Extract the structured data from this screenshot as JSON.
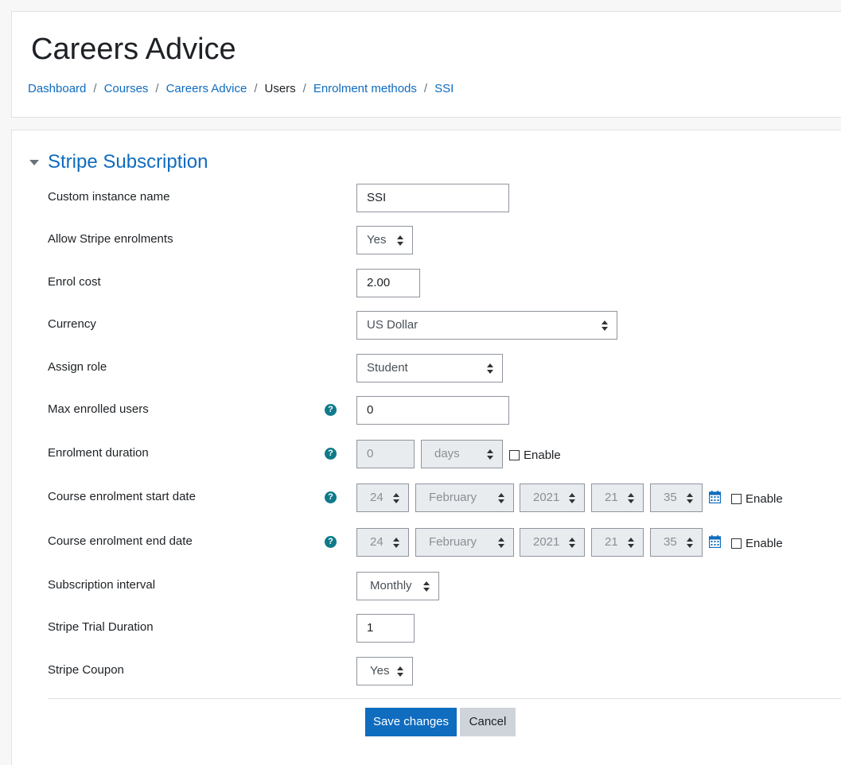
{
  "header": {
    "title": "Careers Advice",
    "breadcrumb": [
      "Dashboard",
      "Courses",
      "Careers Advice",
      "Users",
      "Enrolment methods",
      "SSI"
    ]
  },
  "form": {
    "section_title": "Stripe Subscription",
    "fields": {
      "instance_name": {
        "label": "Custom instance name",
        "value": "SSI"
      },
      "allow_enrol": {
        "label": "Allow Stripe enrolments",
        "value": "Yes"
      },
      "enrol_cost": {
        "label": "Enrol cost",
        "value": "2.00"
      },
      "currency": {
        "label": "Currency",
        "value": "US Dollar"
      },
      "assign_role": {
        "label": "Assign role",
        "value": "Student"
      },
      "max_users": {
        "label": "Max enrolled users",
        "value": "0"
      },
      "duration": {
        "label": "Enrolment duration",
        "value": "0",
        "unit": "days",
        "enable_label": "Enable"
      },
      "start_date": {
        "label": "Course enrolment start date",
        "day": "24",
        "month": "February",
        "year": "2021",
        "hour": "21",
        "minute": "35",
        "enable_label": "Enable"
      },
      "end_date": {
        "label": "Course enrolment end date",
        "day": "24",
        "month": "February",
        "year": "2021",
        "hour": "21",
        "minute": "35",
        "enable_label": "Enable"
      },
      "sub_interval": {
        "label": "Subscription interval",
        "value": "Monthly"
      },
      "trial_duration": {
        "label": "Stripe Trial Duration",
        "value": "1"
      },
      "coupon": {
        "label": "Stripe Coupon",
        "value": "Yes"
      }
    },
    "help_glyph": "?",
    "buttons": {
      "save": "Save changes",
      "cancel": "Cancel"
    }
  },
  "colors": {
    "accent": "#0f6cbf",
    "help": "#0f7a8a"
  }
}
